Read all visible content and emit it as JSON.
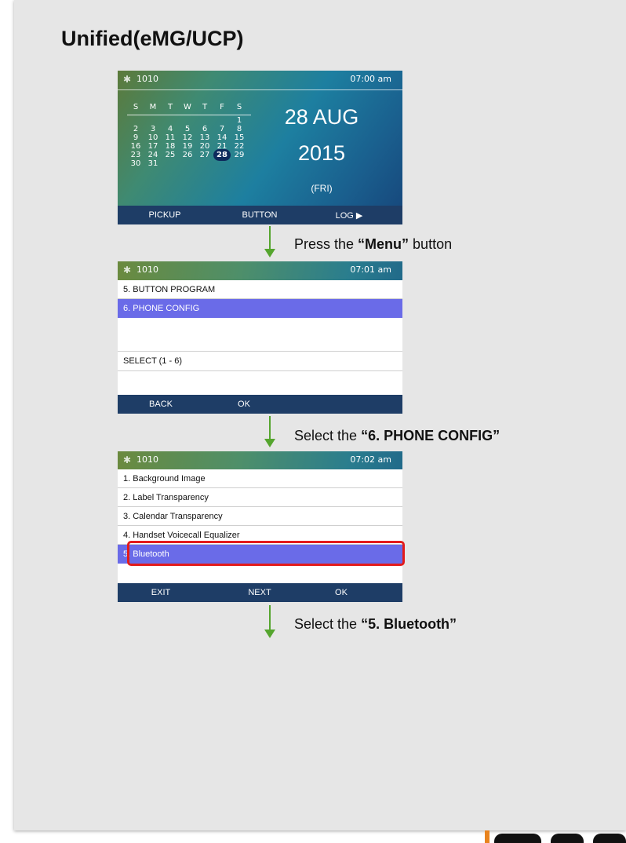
{
  "slide": {
    "title": "Unified(eMG/UCP)"
  },
  "screen1": {
    "extension": "1010",
    "time": "07:00 am",
    "weekdays": [
      "S",
      "M",
      "T",
      "W",
      "T",
      "F",
      "S"
    ],
    "weeks": [
      [
        "",
        "",
        "",
        "",
        "",
        "",
        "1"
      ],
      [
        "2",
        "3",
        "4",
        "5",
        "6",
        "7",
        "8"
      ],
      [
        "9",
        "10",
        "11",
        "12",
        "13",
        "14",
        "15"
      ],
      [
        "16",
        "17",
        "18",
        "19",
        "20",
        "21",
        "22"
      ],
      [
        "23",
        "24",
        "25",
        "26",
        "27",
        "28",
        "29"
      ],
      [
        "30",
        "31",
        "",
        "",
        "",
        "",
        ""
      ]
    ],
    "today": "28",
    "date_label": "28 AUG",
    "year_label": "2015",
    "day_label": "(FRI)",
    "softkeys": {
      "left": "PICKUP",
      "middle": "BUTTON",
      "right": "LOG ▶"
    }
  },
  "step1": {
    "prefix": "Press the ",
    "bold": "“Menu”",
    "suffix": " button"
  },
  "screen2": {
    "extension": "1010",
    "time": "07:01 am",
    "items": [
      "5. BUTTON PROGRAM",
      "6. PHONE CONFIG"
    ],
    "selected_index": 1,
    "prompt": "SELECT (1 - 6)",
    "softkeys": {
      "left": "BACK",
      "middle": "OK"
    }
  },
  "step2": {
    "prefix": "Select the ",
    "bold": "“6. PHONE CONFIG”"
  },
  "screen3": {
    "extension": "1010",
    "time": "07:02 am",
    "items": [
      "1. Background Image",
      "2. Label Transparency",
      "3. Calendar Transparency",
      "4. Handset Voicecall Equalizer",
      "5. Bluetooth"
    ],
    "selected_index": 4,
    "softkeys": {
      "left": "EXIT",
      "middle": "NEXT",
      "right": "OK"
    }
  },
  "step3": {
    "prefix": "Select the ",
    "bold": "“5. Bluetooth”"
  },
  "colors": {
    "selection": "#6a6be8",
    "softbar": "#1e3d66",
    "arrow": "#55a52e",
    "highlight": "#e31b1b"
  },
  "icons": {
    "bluetooth": "bluetooth-icon"
  }
}
